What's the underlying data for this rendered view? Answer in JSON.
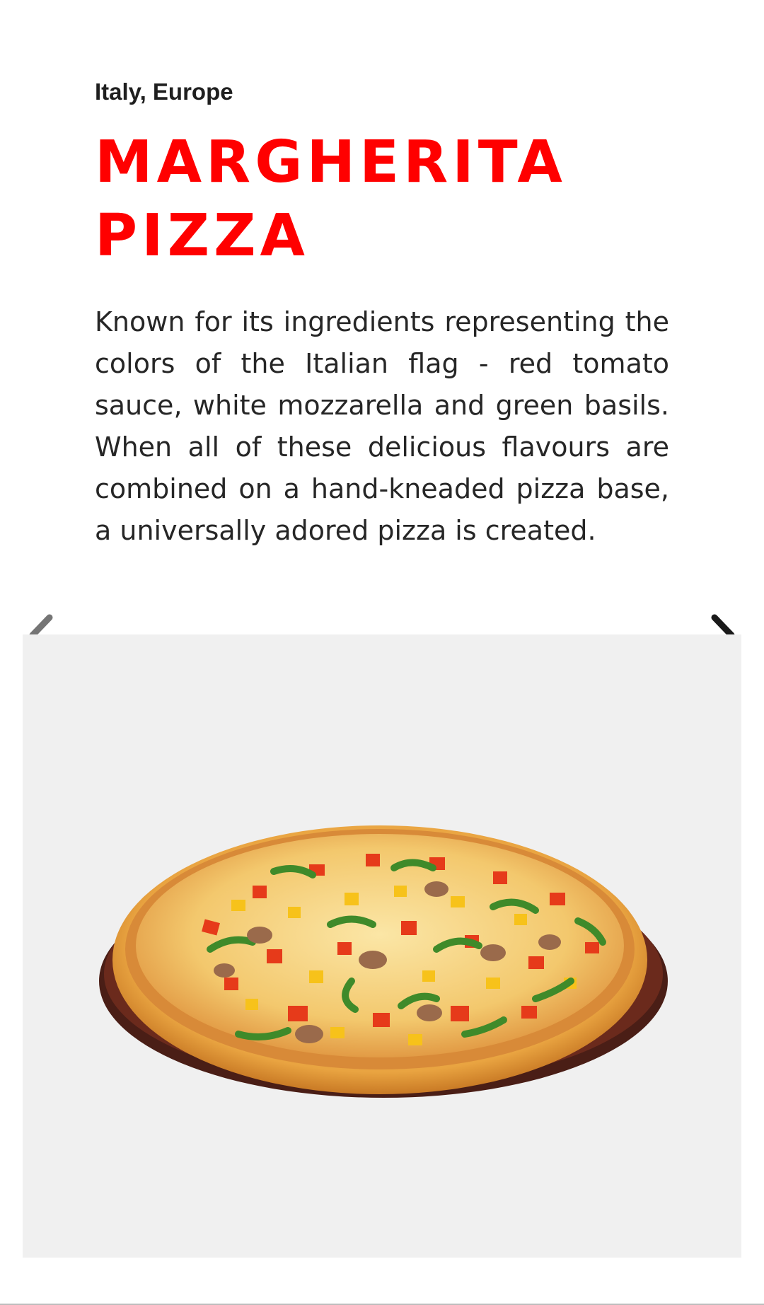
{
  "dish": {
    "origin": "Italy, Europe",
    "title_line1": "MARGHERITA",
    "title_line2": "PIZZA",
    "description": "Known for its ingredients representing the colors of the Italian flag - red tomato sauce, white mozzarella and green basils. When all of these delicious flavours are combined on a hand-kneaded pizza base, a universally adored pizza is created."
  },
  "carousel": {
    "prev_icon": "chevron-left-icon",
    "next_icon": "chevron-right-icon",
    "image": "pizza-image"
  },
  "colors": {
    "title": "#ff0000",
    "text": "#262626",
    "carousel_bg": "#f0f0f0"
  }
}
